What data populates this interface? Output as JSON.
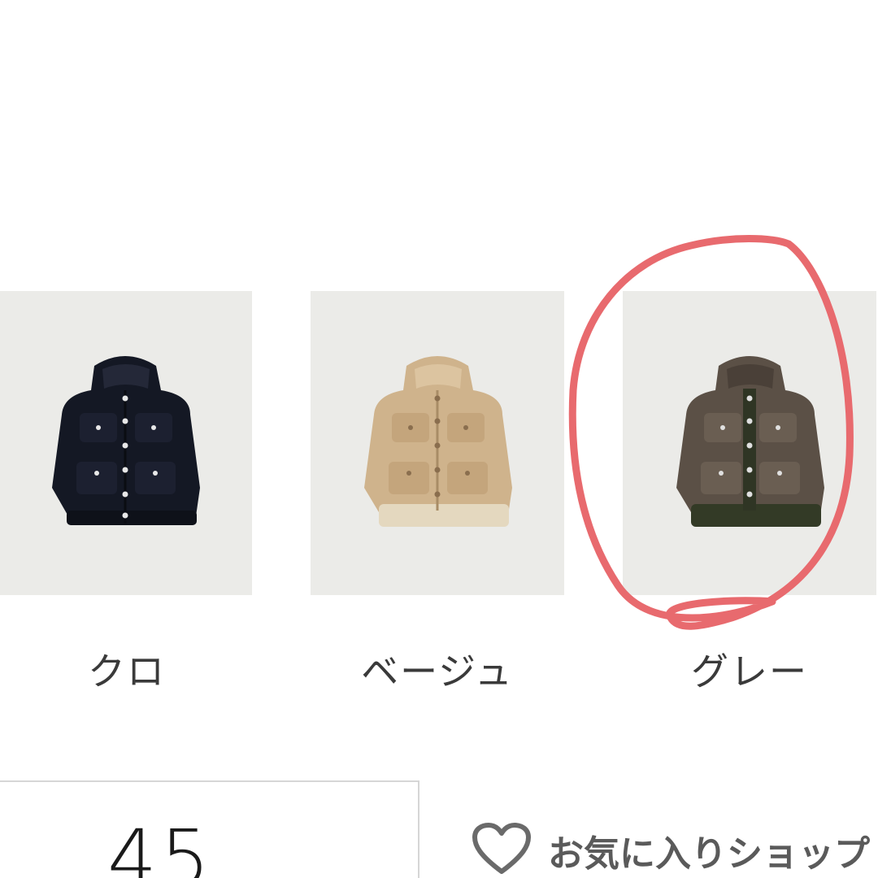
{
  "colors": {
    "swatch_bg": "#ebebe8",
    "vest_black": "#141824",
    "vest_beige": "#cfb38c",
    "vest_grey": "#5b5046",
    "annotation": "#e86a6e"
  },
  "variants": [
    {
      "label": "クロ",
      "icon": "black-vest-image"
    },
    {
      "label": "ベージュ",
      "icon": "beige-vest-image"
    },
    {
      "label": "グレー",
      "icon": "grey-vest-image",
      "circled": true
    }
  ],
  "size": {
    "value": "45"
  },
  "favorites": {
    "label": "お気に入りショップ",
    "icon": "heart-outline-icon"
  }
}
